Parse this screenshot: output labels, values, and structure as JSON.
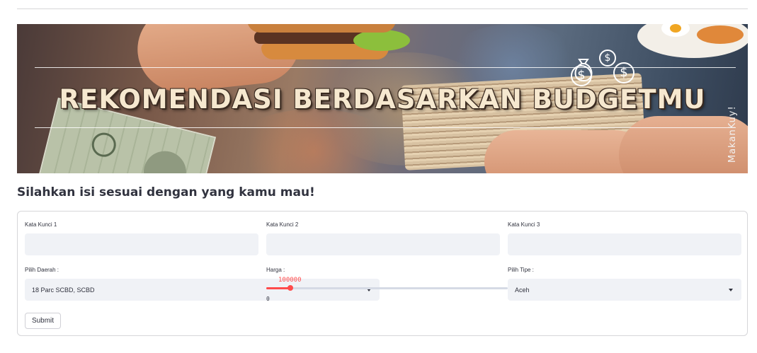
{
  "banner": {
    "title": "REKOMENDASI BERDASARKAN BUDGETMU",
    "brand": "MakanKuy!",
    "coin_symbol": "$"
  },
  "heading": "Silahkan isi sesuai dengan yang kamu mau!",
  "form": {
    "keyword1": {
      "label": "Kata Kunci 1",
      "value": ""
    },
    "keyword2": {
      "label": "Kata Kunci 2",
      "value": ""
    },
    "keyword3": {
      "label": "Kata Kunci 3",
      "value": ""
    },
    "region": {
      "label": "Pilih Daerah :",
      "selected": "18 Parc SCBD, SCBD"
    },
    "price": {
      "label": "Harga :",
      "value": "100000",
      "min": "0",
      "fraction": 0.1
    },
    "type": {
      "label": "Pilih Tipe :",
      "selected": "Aceh"
    },
    "submit_label": "Submit"
  },
  "colors": {
    "accent": "#ff4b4b",
    "field_bg": "#f0f2f6",
    "text": "#31333f"
  },
  "icons": [
    "chevron-down-icon",
    "money-bag-icon",
    "coin-icon"
  ]
}
